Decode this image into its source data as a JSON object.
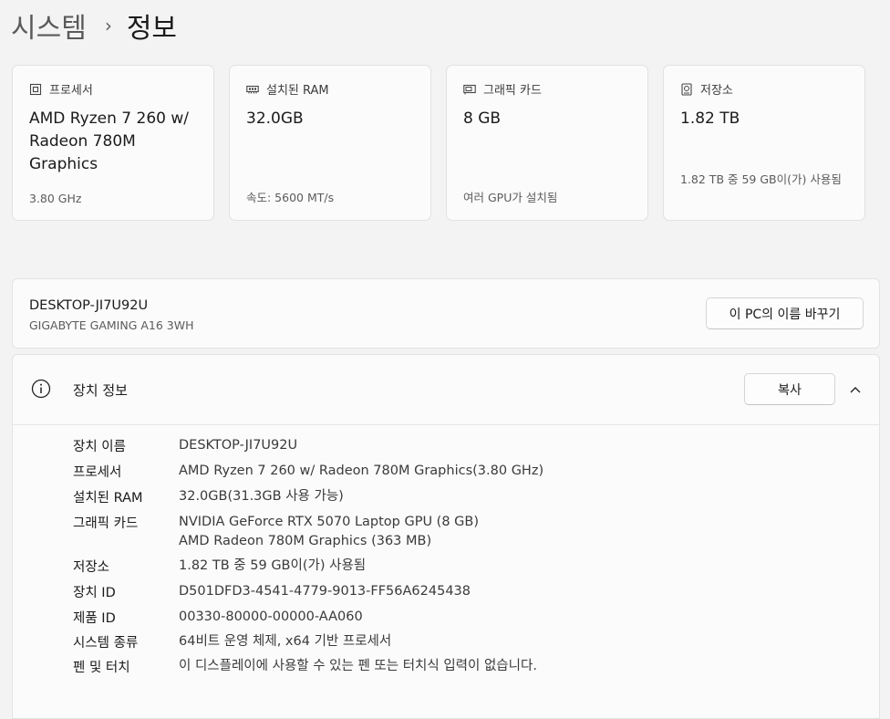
{
  "breadcrumb": {
    "parent": "시스템",
    "separator": "›",
    "current": "정보"
  },
  "cards": [
    {
      "icon": "cpu-icon",
      "header": "프로세서",
      "value": "AMD Ryzen 7 260 w/ Radeon 780M Graphics",
      "sub": "3.80 GHz"
    },
    {
      "icon": "ram-icon",
      "header": "설치된 RAM",
      "value": "32.0GB",
      "sub": "속도: 5600 MT/s"
    },
    {
      "icon": "gpu-icon",
      "header": "그래픽 카드",
      "value": "8 GB",
      "sub": "여러 GPU가 설치됨"
    },
    {
      "icon": "storage-icon",
      "header": "저장소",
      "value": "1.82 TB",
      "sub": "1.82 TB 중 59 GB이(가) 사용됨"
    }
  ],
  "device": {
    "name": "DESKTOP-JI7U92U",
    "model": "GIGABYTE GAMING A16 3WH",
    "rename_label": "이 PC의 이름 바꾸기"
  },
  "device_info": {
    "title": "장치 정보",
    "copy_label": "복사",
    "rows": [
      {
        "label": "장치 이름",
        "value": "DESKTOP-JI7U92U"
      },
      {
        "label": "프로세서",
        "value": "AMD Ryzen 7 260 w/ Radeon 780M Graphics(3.80 GHz)"
      },
      {
        "label": "설치된 RAM",
        "value": "32.0GB(31.3GB 사용 가능)"
      },
      {
        "label": "그래픽 카드",
        "value": "NVIDIA GeForce RTX 5070 Laptop GPU (8 GB)",
        "value2": "AMD Radeon 780M Graphics (363 MB)"
      },
      {
        "label": "저장소",
        "value": "1.82 TB 중 59 GB이(가) 사용됨"
      },
      {
        "label": "장치 ID",
        "value": "D501DFD3-4541-4779-9013-FF56A6245438"
      },
      {
        "label": "제품 ID",
        "value": "00330-80000-00000-AA060"
      },
      {
        "label": "시스템 종류",
        "value": "64비트 운영 체제, x64 기반 프로세서"
      },
      {
        "label": "펜 및 터치",
        "value": "이 디스플레이에 사용할 수 있는 펜 또는 터치식 입력이 없습니다."
      }
    ]
  }
}
